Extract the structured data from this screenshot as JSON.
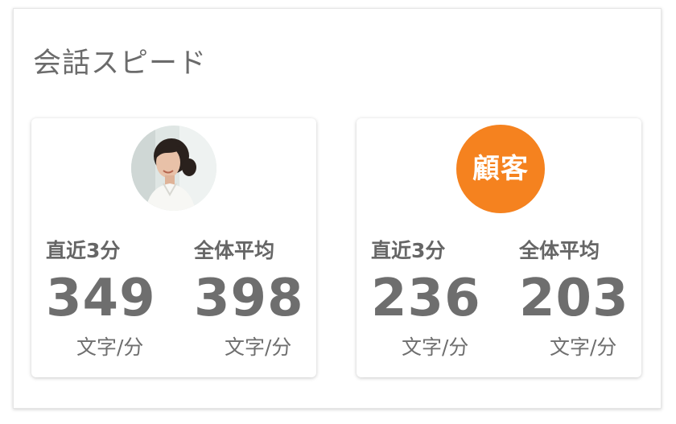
{
  "panel": {
    "title": "会話スピード"
  },
  "cards": [
    {
      "speaker": "operator",
      "avatar_icon": "operator-photo",
      "recent_label": "直近3分",
      "recent_value": "349",
      "recent_unit": "文字/分",
      "average_label": "全体平均",
      "average_value": "398",
      "average_unit": "文字/分"
    },
    {
      "speaker": "customer",
      "badge_label": "顧客",
      "badge_color": "#f5821f",
      "recent_label": "直近3分",
      "recent_value": "236",
      "recent_unit": "文字/分",
      "average_label": "全体平均",
      "average_value": "203",
      "average_unit": "文字/分"
    }
  ]
}
